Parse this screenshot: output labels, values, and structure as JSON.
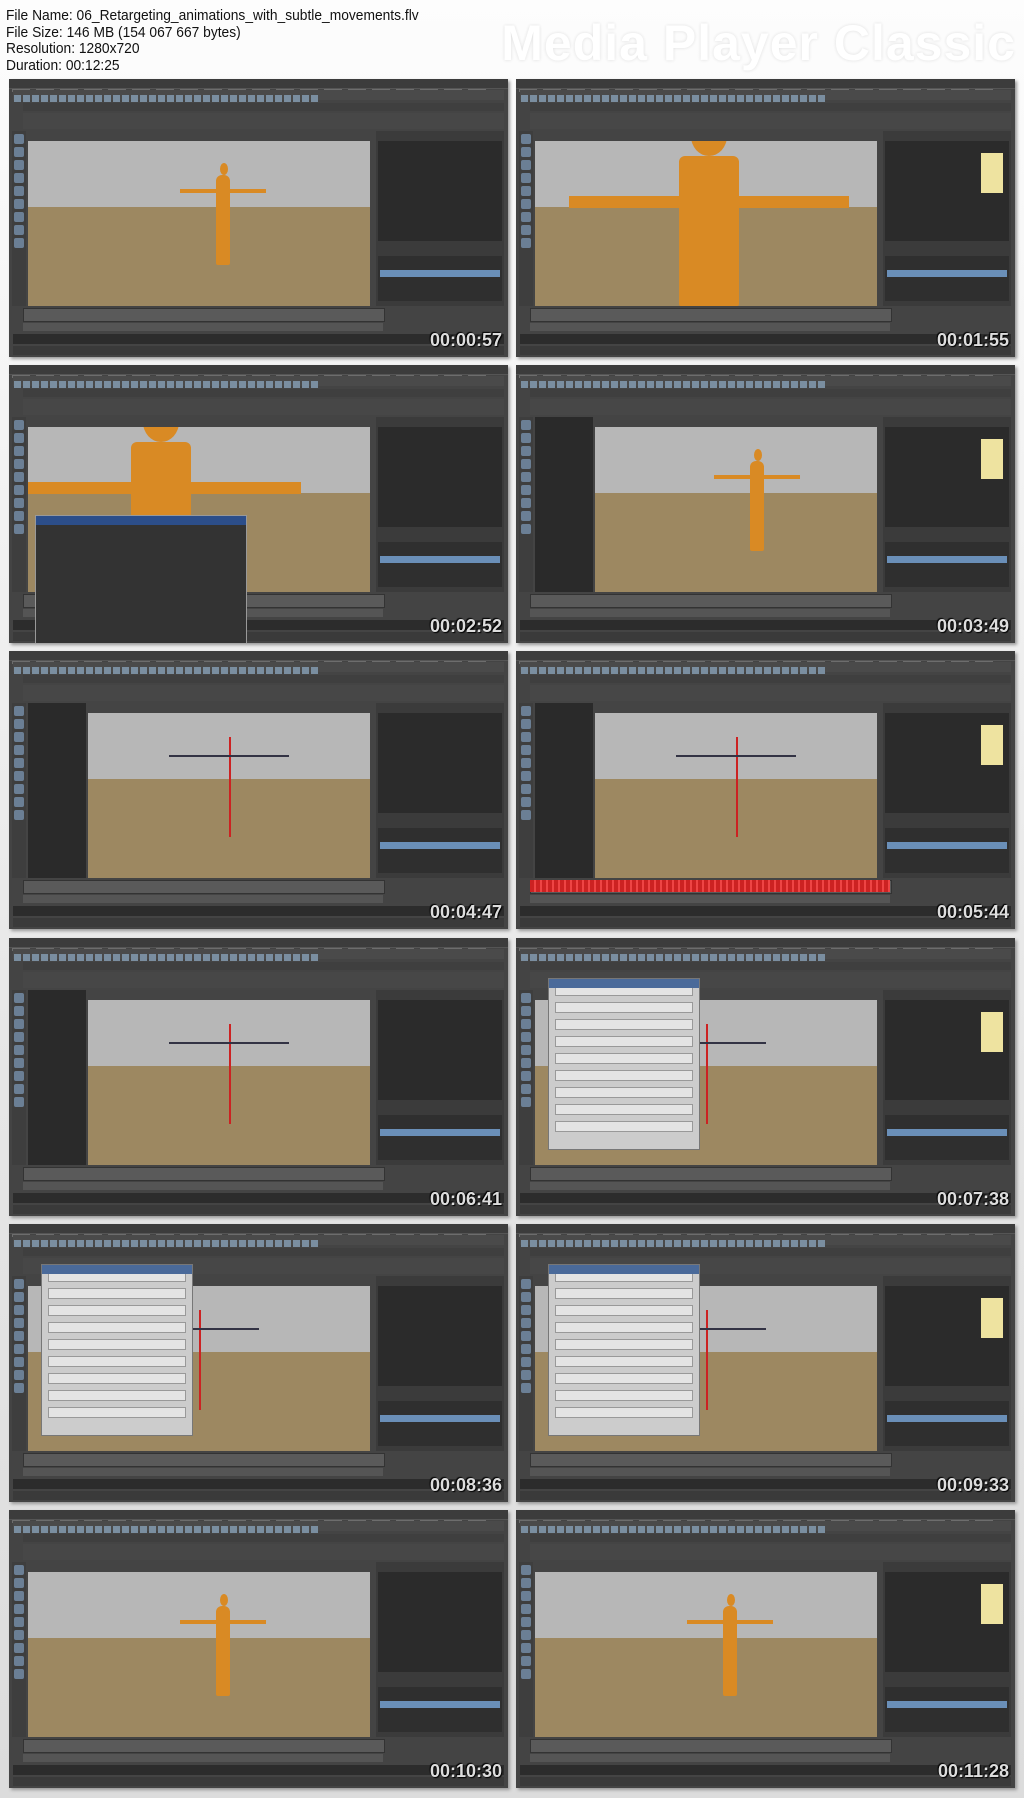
{
  "info": {
    "file_name": "File Name: 06_Retargeting_animations_with_subtle_movements.flv",
    "file_size": "File Size: 146 MB (154 067 667 bytes)",
    "resolution": "Resolution: 1280x720",
    "duration": "Duration: 00:12:25"
  },
  "brand": "Media Player Classic",
  "thumbnails": [
    {
      "timestamp": "00:00:57",
      "scene": "figure-small",
      "outliner": false
    },
    {
      "timestamp": "00:01:55",
      "scene": "figure-closeup",
      "outliner": false
    },
    {
      "timestamp": "00:02:52",
      "scene": "outliner-window",
      "outliner": false
    },
    {
      "timestamp": "00:03:49",
      "scene": "figure-small",
      "outliner": true
    },
    {
      "timestamp": "00:04:47",
      "scene": "skeleton",
      "outliner": true
    },
    {
      "timestamp": "00:05:44",
      "scene": "skeleton-red",
      "outliner": true
    },
    {
      "timestamp": "00:06:41",
      "scene": "skeleton",
      "outliner": true
    },
    {
      "timestamp": "00:07:38",
      "scene": "dialog",
      "outliner": false
    },
    {
      "timestamp": "00:08:36",
      "scene": "dialog",
      "outliner": false
    },
    {
      "timestamp": "00:09:33",
      "scene": "dialog",
      "outliner": false
    },
    {
      "timestamp": "00:10:30",
      "scene": "figure-small",
      "outliner": false
    },
    {
      "timestamp": "00:11:28",
      "scene": "figure-small",
      "outliner": false
    }
  ]
}
